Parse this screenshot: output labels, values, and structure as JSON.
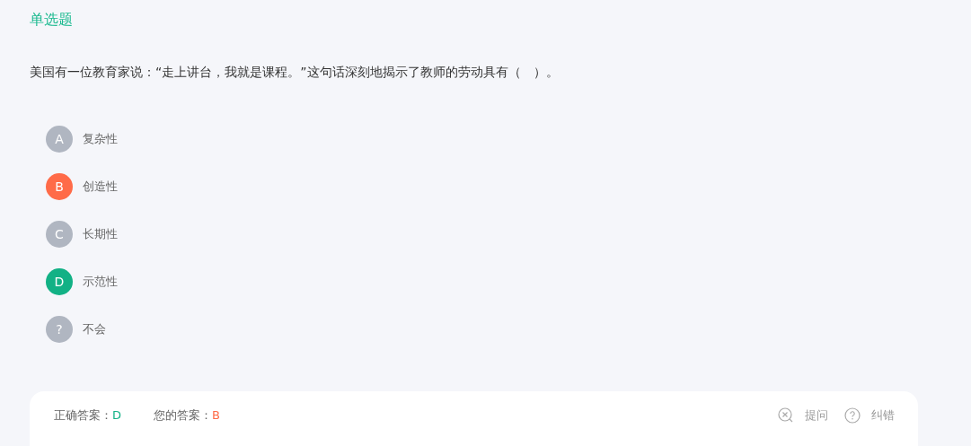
{
  "question_type": "单选题",
  "question": "美国有一位教育家说：“走上讲台，我就是课程。”这句话深刻地揭示了教师的劳动具有（　）。",
  "options": [
    {
      "letter": "A",
      "text": "复杂性",
      "selected": false,
      "correct": false
    },
    {
      "letter": "B",
      "text": "创造性",
      "selected": true,
      "correct": false
    },
    {
      "letter": "C",
      "text": "长期性",
      "selected": false,
      "correct": false
    },
    {
      "letter": "D",
      "text": "示范性",
      "selected": false,
      "correct": true
    },
    {
      "letter": "?",
      "text": "不会",
      "selected": false,
      "correct": false
    }
  ],
  "answer_card": {
    "correct_label": "正确答案：",
    "correct_value": "D",
    "your_label": "您的答案：",
    "your_value": "B",
    "actions": [
      {
        "kind": "ask",
        "label": "提问"
      },
      {
        "kind": "report",
        "label": "纠错"
      }
    ]
  }
}
